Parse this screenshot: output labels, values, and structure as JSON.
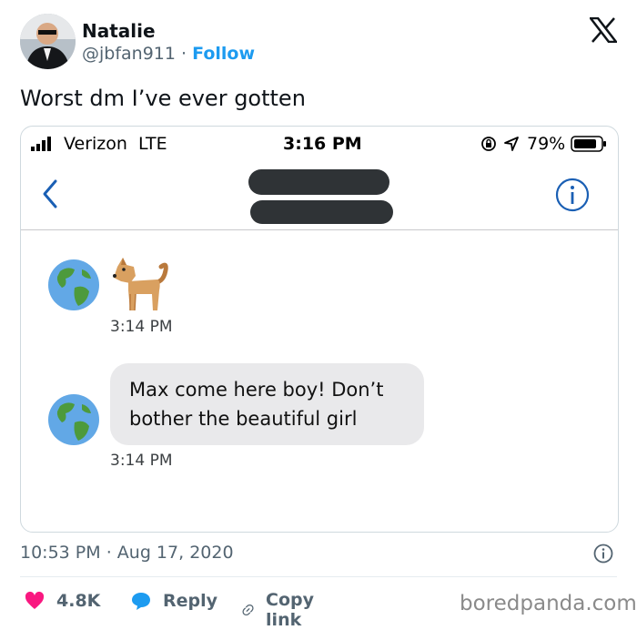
{
  "tweet": {
    "author_name": "Natalie",
    "handle": "@jbfan911",
    "separator": "·",
    "follow_label": "Follow",
    "text": "Worst dm I’ve ever gotten",
    "time": "10:53 PM",
    "date": "Aug 17, 2020",
    "likes": "4.8K",
    "reply_label": "Reply",
    "copy_link_label": "Copy link"
  },
  "phone": {
    "carrier": "Verizon",
    "network": "LTE",
    "clock": "3:16 PM",
    "battery": "79%",
    "messages": [
      {
        "type": "emoji",
        "icon": "dog-emoji",
        "time": "3:14 PM"
      },
      {
        "type": "text",
        "lines": [
          "Max come here boy! Don’t",
          "bother the beautiful girl"
        ],
        "time": "3:14 PM"
      }
    ]
  },
  "watermark": "boredpanda.com",
  "colors": {
    "link_blue": "#1d9bf0",
    "like_pink": "#f91880",
    "ios_blue": "#1a5fb4",
    "bubble_gray": "#e9e9eb"
  },
  "icons": [
    "x-logo-icon",
    "signal-icon",
    "rotation-lock-icon",
    "location-icon",
    "battery-icon",
    "back-chevron-icon",
    "info-icon",
    "globe-icon",
    "dog-emoji",
    "heart-icon",
    "reply-bubble-icon",
    "link-icon"
  ]
}
